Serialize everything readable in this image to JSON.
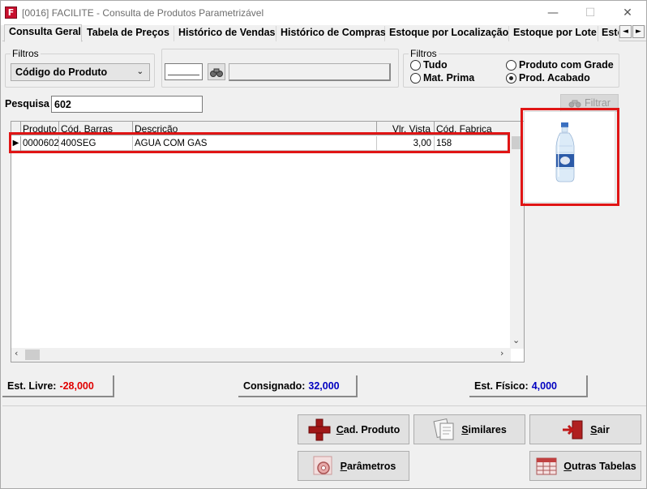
{
  "window": {
    "title": "[0016] FACILITE - Consulta de Produtos Parametrizável",
    "icon_letter": "F",
    "minimize": "—",
    "maximize": "☐",
    "close": "✕"
  },
  "tabs": [
    {
      "label": "Consulta Geral",
      "active": true
    },
    {
      "label": "Tabela de Preços"
    },
    {
      "label": "Histórico de Vendas"
    },
    {
      "label": "Histórico de Compras"
    },
    {
      "label": "Estoque por Localização"
    },
    {
      "label": "Estoque por Lote"
    },
    {
      "label": "Esto"
    }
  ],
  "tab_scroll": {
    "left": "◄",
    "right": "►"
  },
  "filters_left": {
    "legend": "Filtros",
    "selected": "Código do Produto"
  },
  "filters_right": {
    "legend": "Filtros",
    "options": [
      {
        "label": "Tudo",
        "checked": false
      },
      {
        "label": "Produto com Grade",
        "checked": false
      },
      {
        "label": "Mat. Prima",
        "checked": false
      },
      {
        "label": "Prod. Acabado",
        "checked": true
      }
    ]
  },
  "search": {
    "label": "Pesquisa",
    "value": "602"
  },
  "filter_button": "Filtrar",
  "grid": {
    "columns": [
      "Produto",
      "Cód. Barras",
      "Descrição",
      "Vlr. Vista",
      "Cód. Fabrica"
    ],
    "rows": [
      {
        "indicator": "▶",
        "produto": "0000602",
        "cod_barras": "400SEG",
        "descricao": "AGUA COM GAS",
        "vlr_vista": "3,00",
        "cod_fabrica": "158"
      }
    ]
  },
  "stock": {
    "livre_label": "Est. Livre:",
    "livre_value": "-28,000",
    "consignado_label": "Consignado:",
    "consignado_value": "32,000",
    "fisico_label": "Est. Físico:",
    "fisico_value": "4,000"
  },
  "colors": {
    "negative": "#e00000",
    "positive": "#0000c0",
    "highlight": "#e01515"
  },
  "buttons": {
    "cad_produto": {
      "first": "C",
      "rest": "ad. Produto"
    },
    "similares": {
      "first": "S",
      "rest": "imilares"
    },
    "sair": {
      "first": "S",
      "rest": "air"
    },
    "parametros": {
      "first": "P",
      "rest": "arâmetros"
    },
    "outras_tabelas": {
      "first": "O",
      "rest": "utras Tabelas"
    }
  }
}
